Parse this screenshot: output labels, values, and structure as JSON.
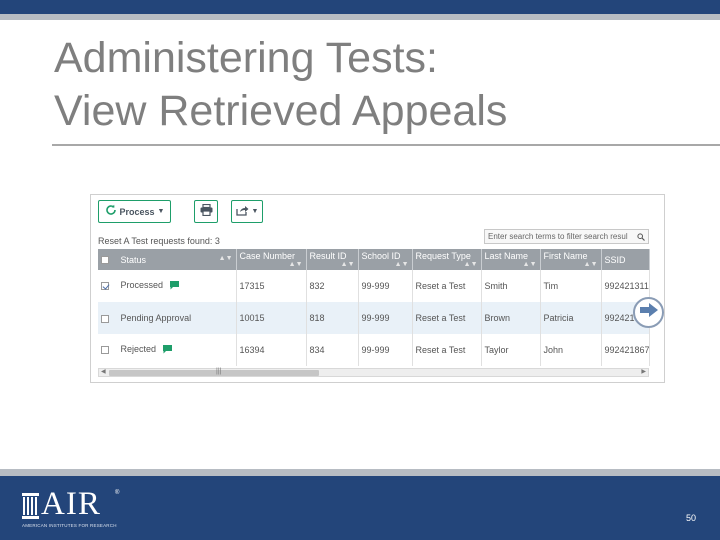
{
  "slide": {
    "title_line1": "Administering Tests:",
    "title_line2": "View Retrieved Appeals",
    "page_number": "50"
  },
  "toolbar": {
    "process_label": "Process",
    "process_icon": "refresh-icon",
    "print_icon": "print-icon",
    "export_icon": "export-icon"
  },
  "filter": {
    "placeholder": "Enter search terms to filter search resul"
  },
  "results": {
    "count_text": "Reset A Test requests found: 3"
  },
  "table": {
    "columns": [
      "Status",
      "Case Number",
      "Result ID",
      "School ID",
      "Request Type",
      "Last Name",
      "First Name",
      "SSID"
    ],
    "rows": [
      {
        "checked": true,
        "status": "Processed",
        "has_comment": true,
        "case_number": "17315",
        "result_id": "832",
        "school_id": "99-999",
        "request_type": "Reset a Test",
        "last_name": "Smith",
        "first_name": "Tim",
        "ssid": "992421311"
      },
      {
        "checked": false,
        "status": "Pending Approval",
        "has_comment": false,
        "case_number": "10015",
        "result_id": "818",
        "school_id": "99-999",
        "request_type": "Reset a Test",
        "last_name": "Brown",
        "first_name": "Patricia",
        "ssid": "9924215"
      },
      {
        "checked": false,
        "status": "Rejected",
        "has_comment": true,
        "case_number": "16394",
        "result_id": "834",
        "school_id": "99-999",
        "request_type": "Reset a Test",
        "last_name": "Taylor",
        "first_name": "John",
        "ssid": "992421867"
      }
    ]
  },
  "branding": {
    "logo_text": "AIR",
    "logo_subtitle": "AMERICAN INSTITUTES FOR RESEARCH",
    "registered_mark": "®"
  },
  "colors": {
    "header_bar": "#23457a",
    "accent_green": "#1e9e6a",
    "table_header": "#9aa0a6",
    "row_alt": "#e9f1f8"
  }
}
